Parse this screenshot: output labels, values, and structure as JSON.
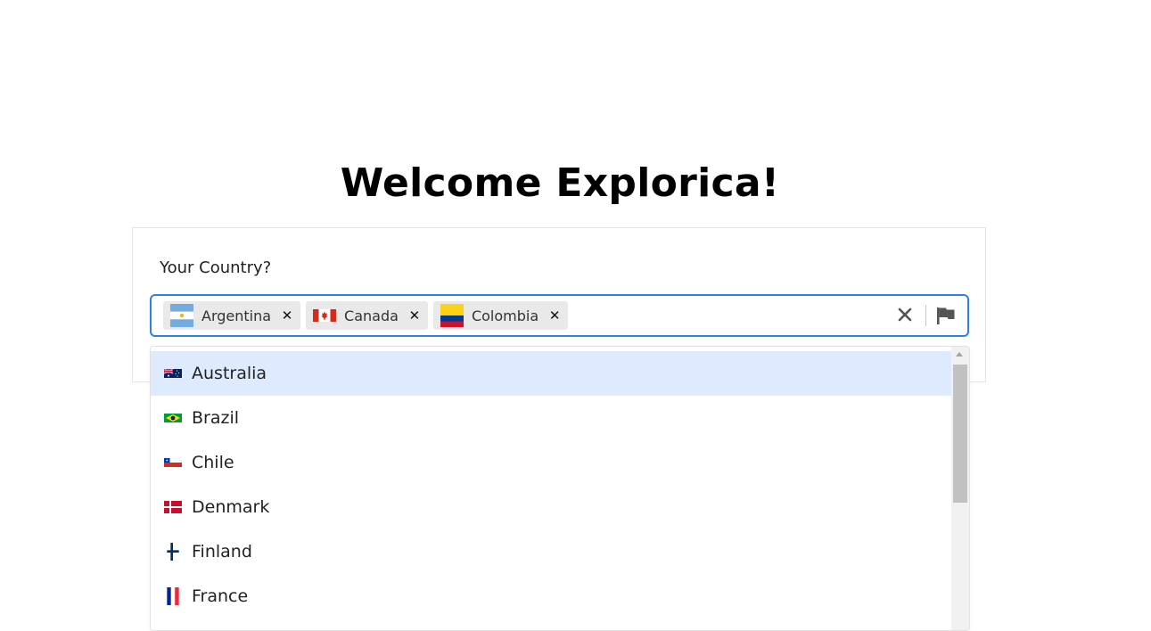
{
  "page": {
    "title": "Welcome Explorica!"
  },
  "form": {
    "label": "Your Country?",
    "selected": [
      {
        "label": "Argentina",
        "flag": "argentina-flag"
      },
      {
        "label": "Canada",
        "flag": "canada-flag"
      },
      {
        "label": "Colombia",
        "flag": "colombia-flag"
      }
    ],
    "clear_icon": "close-icon",
    "toggle_icon": "flag-icon"
  },
  "menu": {
    "focused_index": 0,
    "options": [
      {
        "label": "Australia",
        "flag": "australia-flag"
      },
      {
        "label": "Brazil",
        "flag": "brazil-flag"
      },
      {
        "label": "Chile",
        "flag": "chile-flag"
      },
      {
        "label": "Denmark",
        "flag": "denmark-flag"
      },
      {
        "label": "Finland",
        "flag": "finland-flag"
      },
      {
        "label": "France",
        "flag": "france-flag"
      }
    ]
  },
  "colors": {
    "focus_border": "#2f80ed",
    "focused_option_bg": "#deebff",
    "chip_bg": "#e9e9e9"
  }
}
